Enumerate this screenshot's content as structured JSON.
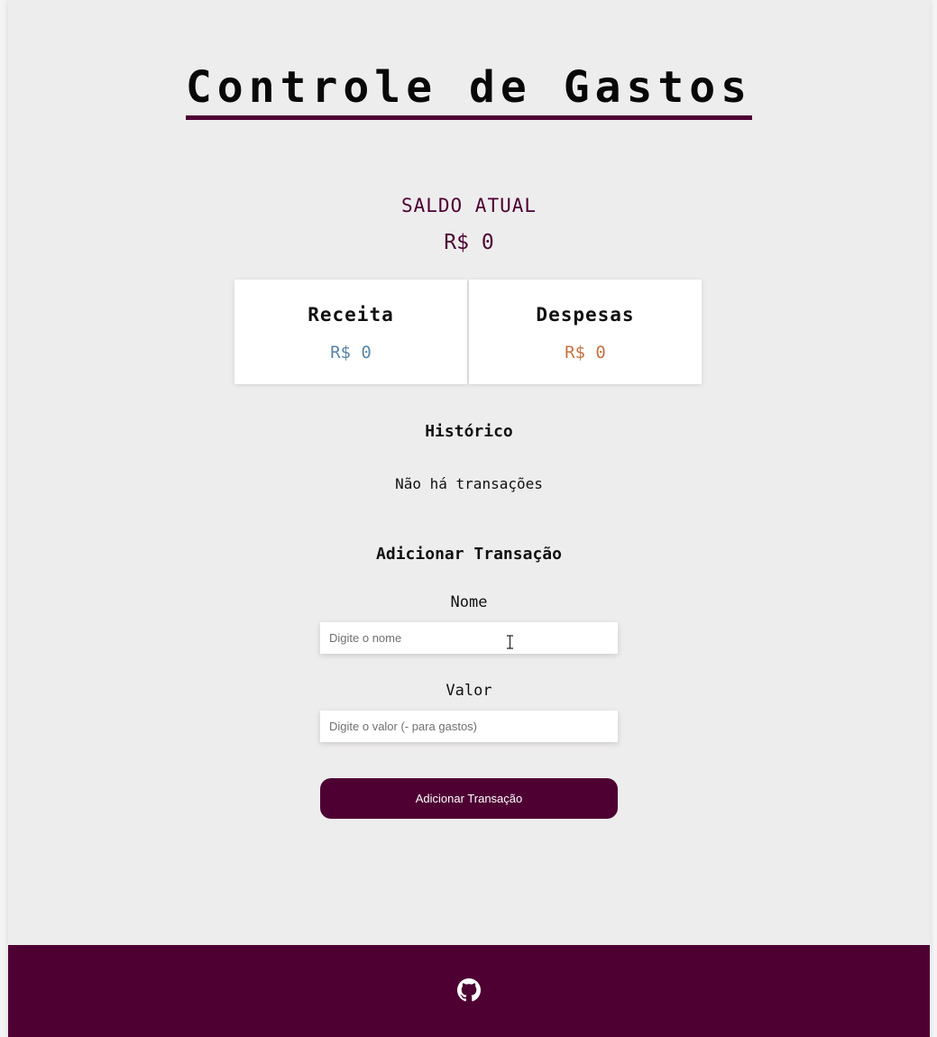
{
  "header": {
    "title": "Controle de Gastos"
  },
  "balance": {
    "label": "SALDO ATUAL",
    "value": "R$ 0"
  },
  "summary": {
    "income": {
      "title": "Receita",
      "value": "R$ 0"
    },
    "expense": {
      "title": "Despesas",
      "value": "R$ 0"
    }
  },
  "history": {
    "title": "Histórico",
    "empty_message": "Não há transações"
  },
  "form": {
    "title": "Adicionar Transação",
    "name_label": "Nome",
    "name_placeholder": "Digite o nome",
    "value_label": "Valor",
    "value_placeholder": "Digite o valor (- para gastos)",
    "submit_label": "Adicionar Transação"
  },
  "footer": {
    "icon": "github-icon"
  },
  "colors": {
    "accent": "#4e0033",
    "income": "#5a86a8",
    "expense": "#c6733f",
    "background": "#eeeded"
  }
}
